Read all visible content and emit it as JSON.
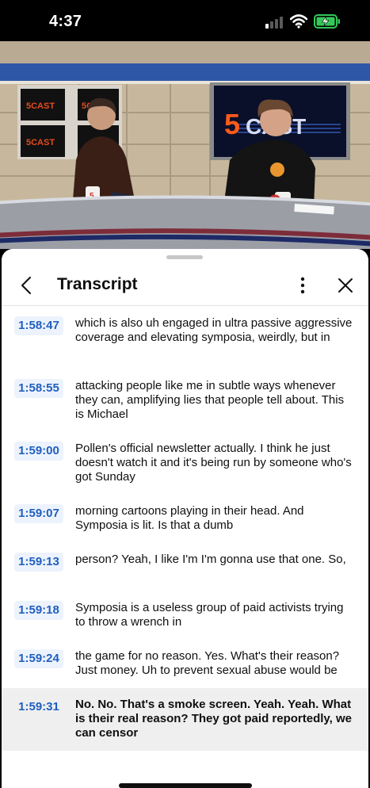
{
  "status_bar": {
    "time": "4:37"
  },
  "video": {
    "logo_text": "5CAST"
  },
  "transcript": {
    "title": "Transcript",
    "segments": [
      {
        "time": "1:58:47",
        "text": "which is also uh engaged in ultra passive aggressive coverage and elevating symposia, weirdly, but in"
      },
      {
        "time": "1:58:55",
        "text": "attacking people like me in subtle ways whenever they can, amplifying lies that people tell about. This is Michael"
      },
      {
        "time": "1:59:00",
        "text": "Pollen's official newsletter actually. I think he just doesn't watch it and it's being run by someone who's got Sunday"
      },
      {
        "time": "1:59:07",
        "text": "morning cartoons playing in their head. And Symposia is lit. Is that a dumb"
      },
      {
        "time": "1:59:13",
        "text": "person? Yeah, I like I'm I'm gonna use that one. So,"
      },
      {
        "time": "1:59:18",
        "text": "Symposia is a useless group of paid activists trying to throw a wrench in"
      },
      {
        "time": "1:59:24",
        "text": "the game for no reason. Yes. What's their reason? Just money. Uh to prevent sexual abuse would be"
      },
      {
        "time": "1:59:31",
        "text": "No. No. That's a smoke screen. Yeah. Yeah. What is their real reason? They got paid reportedly, we can censor"
      }
    ]
  },
  "colors": {
    "timestamp_text": "#1f5fbf",
    "timestamp_bg": "#edf3fd",
    "active_row_bg": "#efefef",
    "battery_green": "#34c759"
  }
}
